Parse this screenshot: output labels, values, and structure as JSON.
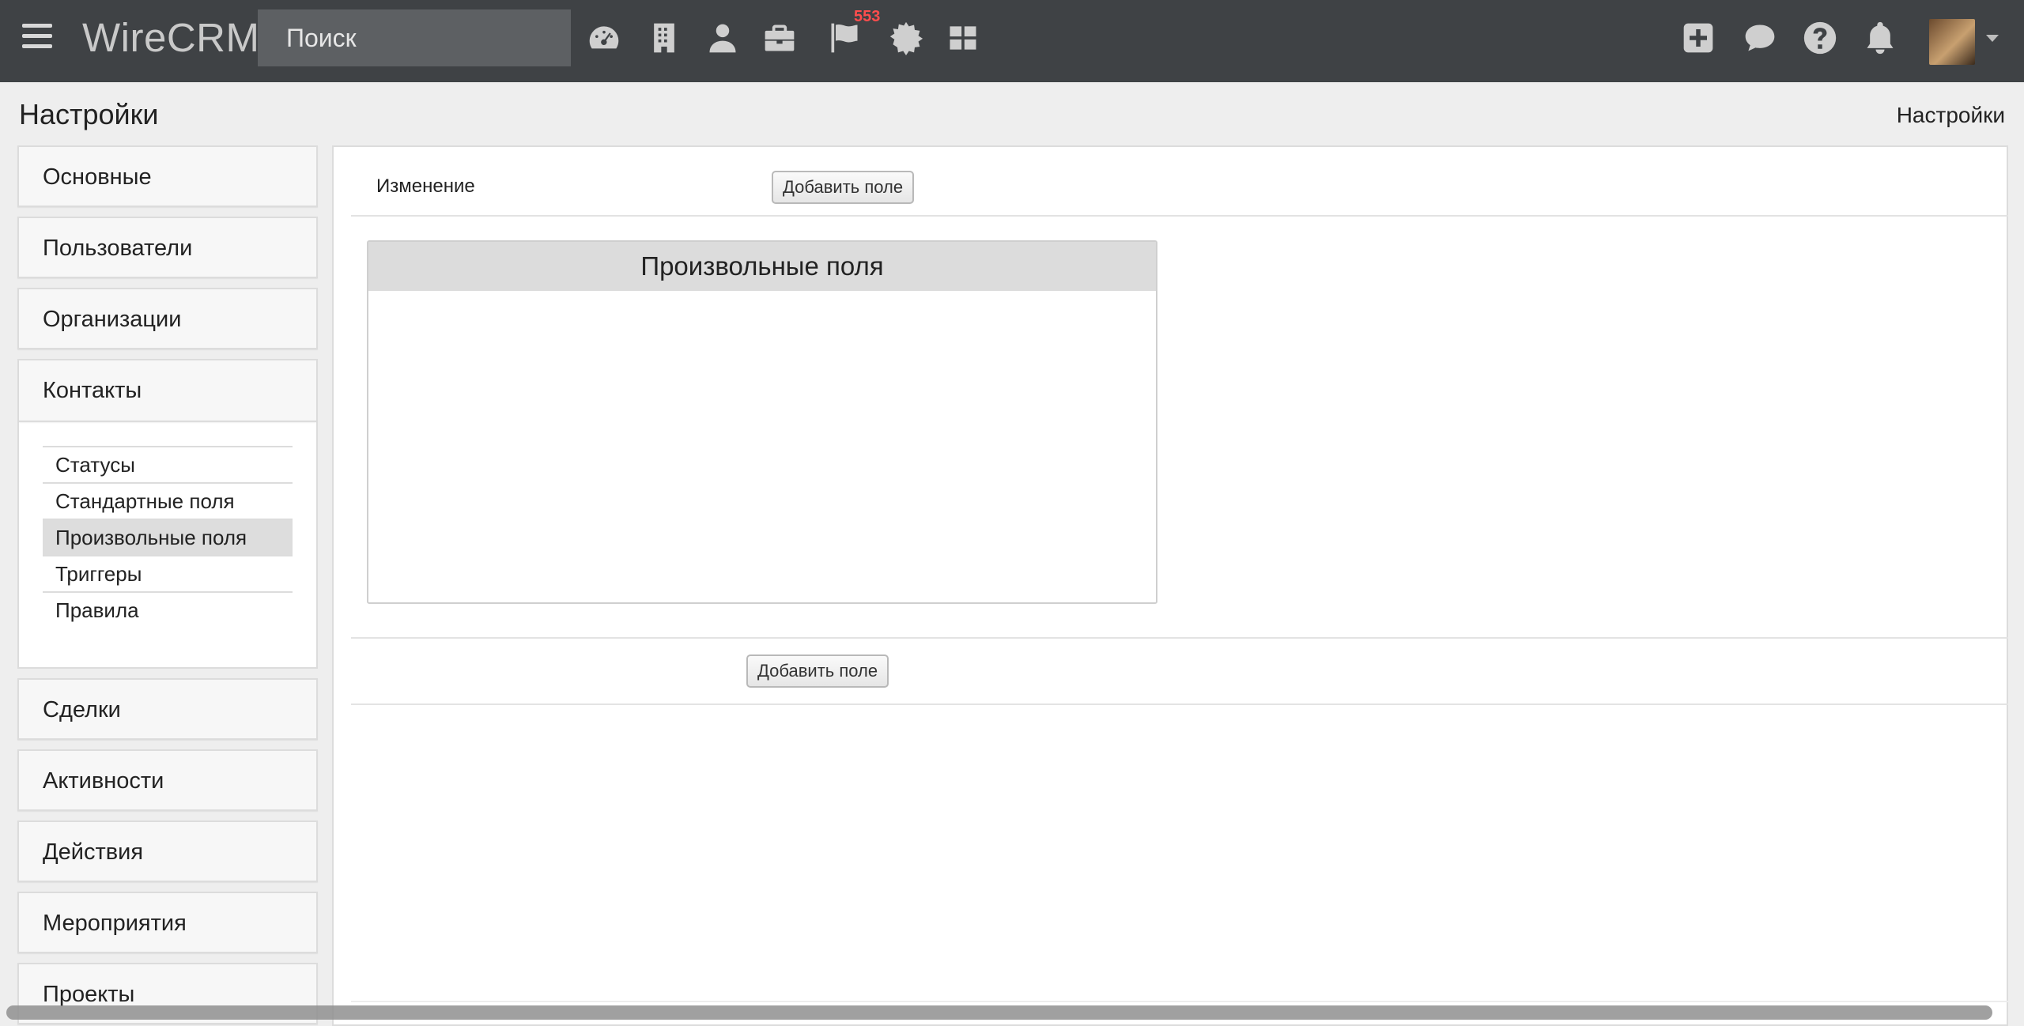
{
  "app": {
    "brand": "WireCRM"
  },
  "search": {
    "placeholder": "Поиск"
  },
  "nav": {
    "icons": [
      "dashboard-icon",
      "building-icon",
      "person-icon",
      "briefcase-icon",
      "flag-icon",
      "gear-icon",
      "grid-icon"
    ],
    "flag_badge": "553",
    "right_icons": [
      "plus-square-icon",
      "comment-icon",
      "question-icon",
      "bell-icon"
    ]
  },
  "page": {
    "title": "Настройки",
    "breadcrumb": "Настройки"
  },
  "sidebar": {
    "items": [
      "Основные",
      "Пользователи",
      "Организации",
      "Контакты",
      "Сделки",
      "Активности",
      "Действия",
      "Мероприятия",
      "Проекты"
    ],
    "contacts_sub": [
      "Статусы",
      "Стандартные поля",
      "Произвольные поля",
      "Триггеры",
      "Правила"
    ],
    "active_sub": "Произвольные поля"
  },
  "main": {
    "row_label": "Изменение",
    "add_field_label": "Добавить поле",
    "panel_title": "Произвольные поля",
    "add_field_bottom_label": "Добавить поле"
  },
  "colors": {
    "topbar": "#3f4245",
    "badge": "#ff4d4d",
    "active_item": "#dddddd"
  }
}
